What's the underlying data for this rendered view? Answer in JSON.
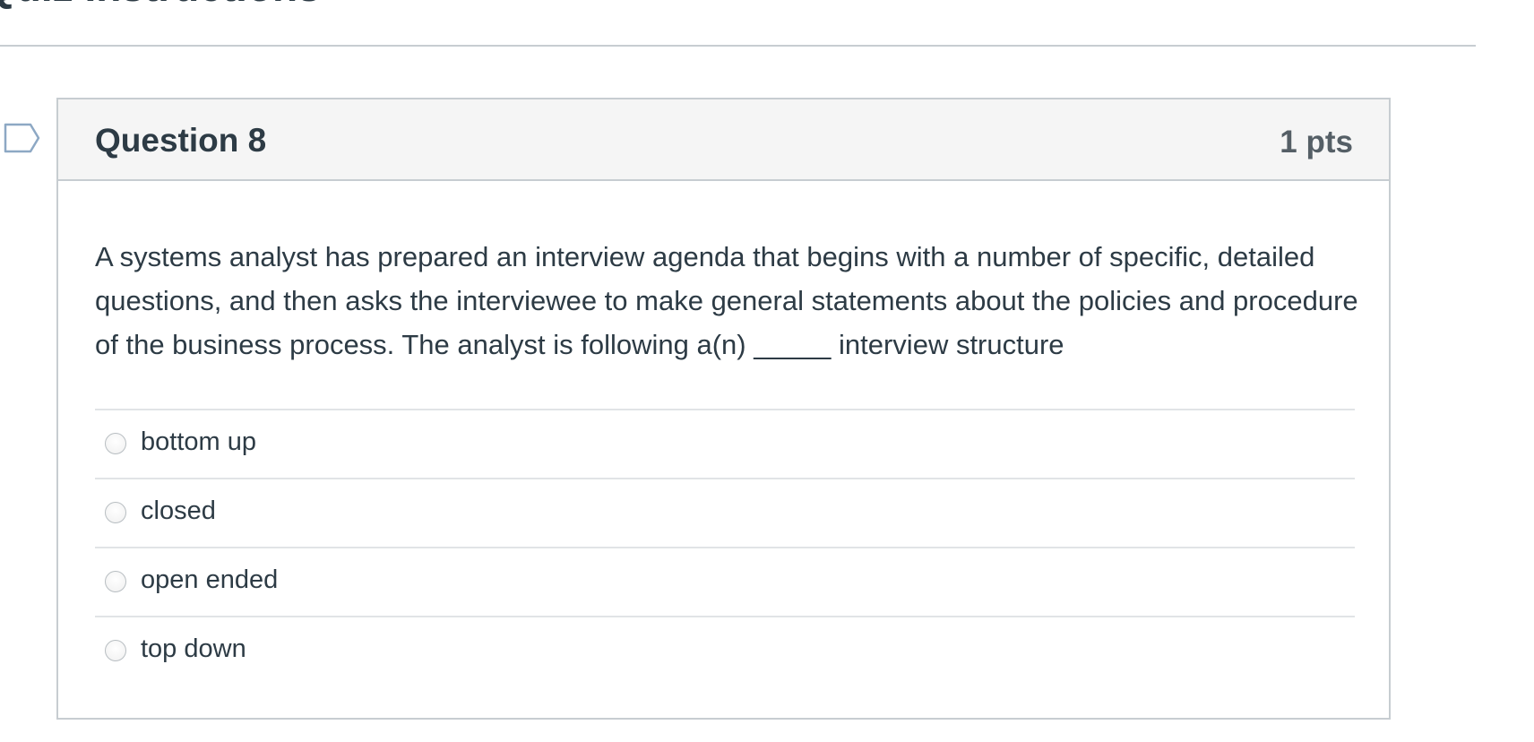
{
  "page": {
    "title": "Quiz Instructions"
  },
  "question": {
    "name": "Question 8",
    "points": "1 pts",
    "text": "A systems analyst has prepared an interview agenda that begins with a number of specific, detailed questions, and then asks the interviewee to make general statements about the policies and procedure of the business process.  The analyst is following a(n) _____ interview structure",
    "flag_icon": "flag-icon",
    "answers": [
      {
        "label": "bottom up",
        "selected": false
      },
      {
        "label": "closed",
        "selected": false
      },
      {
        "label": "open ended",
        "selected": false
      },
      {
        "label": "top down",
        "selected": false
      }
    ]
  },
  "colors": {
    "text": "#2d3b45",
    "header_bg": "#f5f5f5",
    "border": "#c7cdd1",
    "divider": "#e1e4e6",
    "flag": "#8da8c4"
  }
}
